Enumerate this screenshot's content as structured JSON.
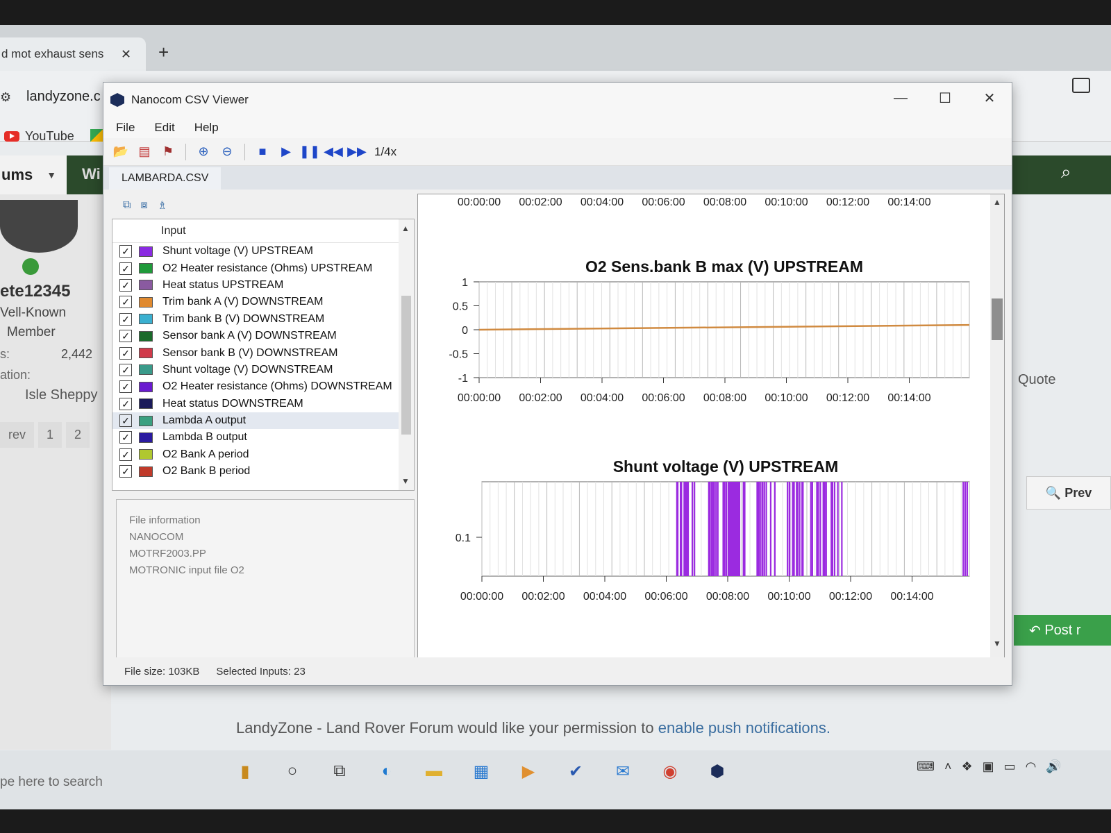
{
  "browser": {
    "tab_title": "d mot exhaust sens",
    "tab_close": "✕",
    "new_tab": "+",
    "url": "landyzone.c",
    "bookmarks": {
      "youtube": "YouTube"
    }
  },
  "forum": {
    "nav_tab": "ums",
    "nav_partial": "Wi",
    "username": "ete12345",
    "role_line1": "Vell-Known",
    "role_line2": "Member",
    "stat_label": "s:",
    "stat_value": "2,442",
    "location_label": "ation:",
    "location_value": "Isle Sheppy",
    "pager": [
      "rev",
      "1",
      "2"
    ],
    "quote": "Quote",
    "preview": "Prev",
    "post": "Post r",
    "push_text": "LandyZone - Land Rover Forum would like your permission to ",
    "push_link": "enable push notifications."
  },
  "taskbar": {
    "search": "pe here to search"
  },
  "app": {
    "title": "Nanocom CSV Viewer",
    "window_buttons": [
      "—",
      "☐",
      "✕"
    ],
    "menu": [
      "File",
      "Edit",
      "Help"
    ],
    "speed": "1/4x",
    "file_tab": "LAMBARDA.CSV",
    "list_header": "Input",
    "inputs": [
      {
        "label": "Shunt voltage (V) UPSTREAM",
        "color": "#8a2be2"
      },
      {
        "label": "O2 Heater resistance (Ohms) UPSTREAM",
        "color": "#1f9a3a"
      },
      {
        "label": "Heat status UPSTREAM",
        "color": "#8a5aa0"
      },
      {
        "label": "Trim bank A (V) DOWNSTREAM",
        "color": "#e08a30"
      },
      {
        "label": "Trim bank B (V) DOWNSTREAM",
        "color": "#3ab0d0"
      },
      {
        "label": "Sensor bank A (V) DOWNSTREAM",
        "color": "#1a6a2a"
      },
      {
        "label": "Sensor bank B (V) DOWNSTREAM",
        "color": "#d03a4a"
      },
      {
        "label": "Shunt voltage (V) DOWNSTREAM",
        "color": "#3a9a8a"
      },
      {
        "label": "O2 Heater resistance (Ohms) DOWNSTREAM",
        "color": "#6a1ad0"
      },
      {
        "label": "Heat status DOWNSTREAM",
        "color": "#1a1a5a"
      },
      {
        "label": "Lambda A output",
        "color": "#3aa080"
      },
      {
        "label": "Lambda B output",
        "color": "#2a1aa0"
      },
      {
        "label": "O2 Bank A period",
        "color": "#b0c830"
      },
      {
        "label": "O2 Bank B period",
        "color": "#c03a2a"
      }
    ],
    "info_lines": [
      "File information",
      "NANOCOM",
      "MOTRF2003.PP",
      "MOTRONIC input file O2"
    ],
    "status": {
      "file_size": "File size: 103KB",
      "selected": "Selected Inputs: 23"
    }
  },
  "chart_data": [
    {
      "type": "line",
      "title": "O2 Sens.bank B max (V) UPSTREAM",
      "x": [
        "00:00:00",
        "00:15:30"
      ],
      "series": [
        {
          "values": [
            0,
            0.1
          ],
          "color": "#d08a40"
        }
      ],
      "xticks": [
        "00:00:00",
        "00:02:00",
        "00:04:00",
        "00:06:00",
        "00:08:00",
        "00:10:00",
        "00:12:00",
        "00:14:00"
      ],
      "yticks": [
        "1",
        "0.5",
        "0",
        "-0.5",
        "-1"
      ],
      "ylim": [
        -1,
        1
      ],
      "grid": true
    },
    {
      "type": "bar",
      "title": "Shunt voltage (V) UPSTREAM",
      "series": [
        {
          "color": "#9b2be0"
        }
      ],
      "xticks": [
        "00:00:00",
        "00:02:00",
        "00:04:00",
        "00:06:00",
        "00:08:00",
        "00:10:00",
        "00:12:00",
        "00:14:00"
      ],
      "yticks": [
        "0.1"
      ],
      "grid": true
    }
  ],
  "top_axis_ticks": [
    "00:00:00",
    "00:02:00",
    "00:04:00",
    "00:06:00",
    "00:08:00",
    "00:10:00",
    "00:12:00",
    "00:14:00"
  ]
}
